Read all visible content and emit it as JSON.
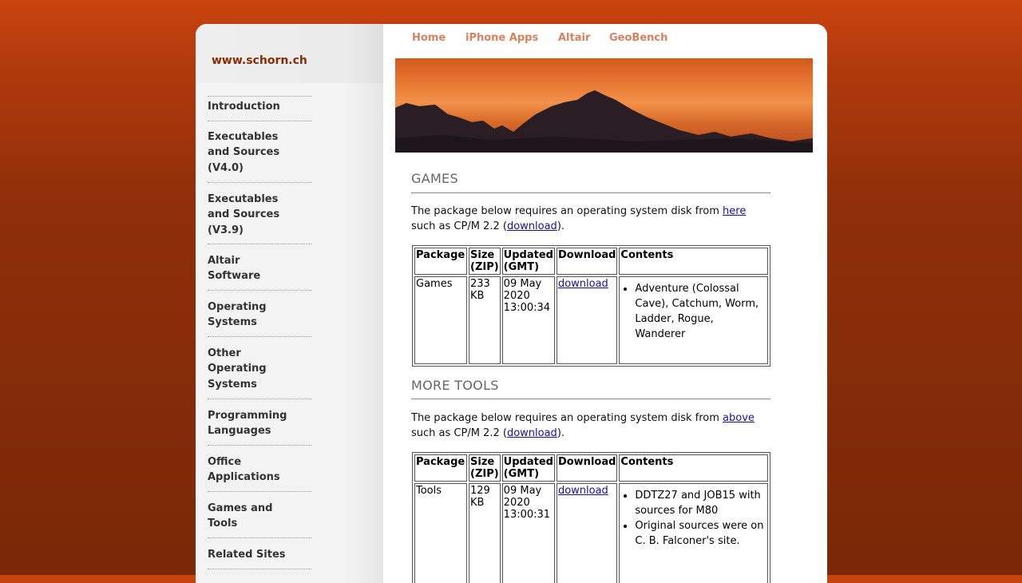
{
  "site_title": "www.schorn.ch",
  "top_nav": [
    "Home",
    "iPhone Apps",
    "Altair",
    "GeoBench"
  ],
  "sidebar": {
    "items": [
      {
        "lines": [
          "Introduction"
        ]
      },
      {
        "lines": [
          "Executables",
          "and Sources",
          "(V4.0)"
        ]
      },
      {
        "lines": [
          "Executables",
          "and Sources",
          "(V3.9)"
        ]
      },
      {
        "lines": [
          "Altair",
          "Software"
        ]
      },
      {
        "lines": [
          "Operating",
          "Systems"
        ]
      },
      {
        "lines": [
          "Other",
          "Operating",
          "Systems"
        ]
      },
      {
        "lines": [
          "Programming",
          "Languages"
        ]
      },
      {
        "lines": [
          "Office",
          "Applications"
        ]
      },
      {
        "lines": [
          "Games and",
          "Tools"
        ]
      },
      {
        "lines": [
          "Related Sites"
        ]
      }
    ]
  },
  "sections": [
    {
      "title": "GAMES",
      "intro_text": "The package below requires an operating system disk from ",
      "intro_link": "here",
      "second_text_pre": "such as CP/M 2.2 (",
      "second_link": "download",
      "second_text_post": ").",
      "table": {
        "headers": [
          "Package",
          "Size (ZIP)",
          "Updated (GMT)",
          "Download",
          "Contents"
        ],
        "row": {
          "package": "Games",
          "size": "233 KB",
          "updated": "09 May 2020 13:00:34",
          "download": "download",
          "contents": [
            "Adventure (Colossal Cave), Catchum, Worm, Ladder, Rogue, Wanderer"
          ]
        }
      }
    },
    {
      "title": "MORE TOOLS",
      "intro_text": "The package below requires an operating system disk from ",
      "intro_link": "above",
      "second_text_pre": "such as CP/M 2.2 (",
      "second_link": "download",
      "second_text_post": ").",
      "table": {
        "headers": [
          "Package",
          "Size (ZIP)",
          "Updated (GMT)",
          "Download",
          "Contents"
        ],
        "row": {
          "package": "Tools",
          "size": "129 KB",
          "updated": "09 May 2020 13:00:31",
          "download": "download",
          "contents": [
            "DDTZ27 and JOB15 with sources for M80",
            "Original sources were on C. B. Falconer's site."
          ]
        }
      }
    }
  ],
  "colors": {
    "background": "#8f2f0a",
    "site_title": "#8a2b06",
    "top_nav": "#d9825d",
    "link": "#1a0dab"
  }
}
